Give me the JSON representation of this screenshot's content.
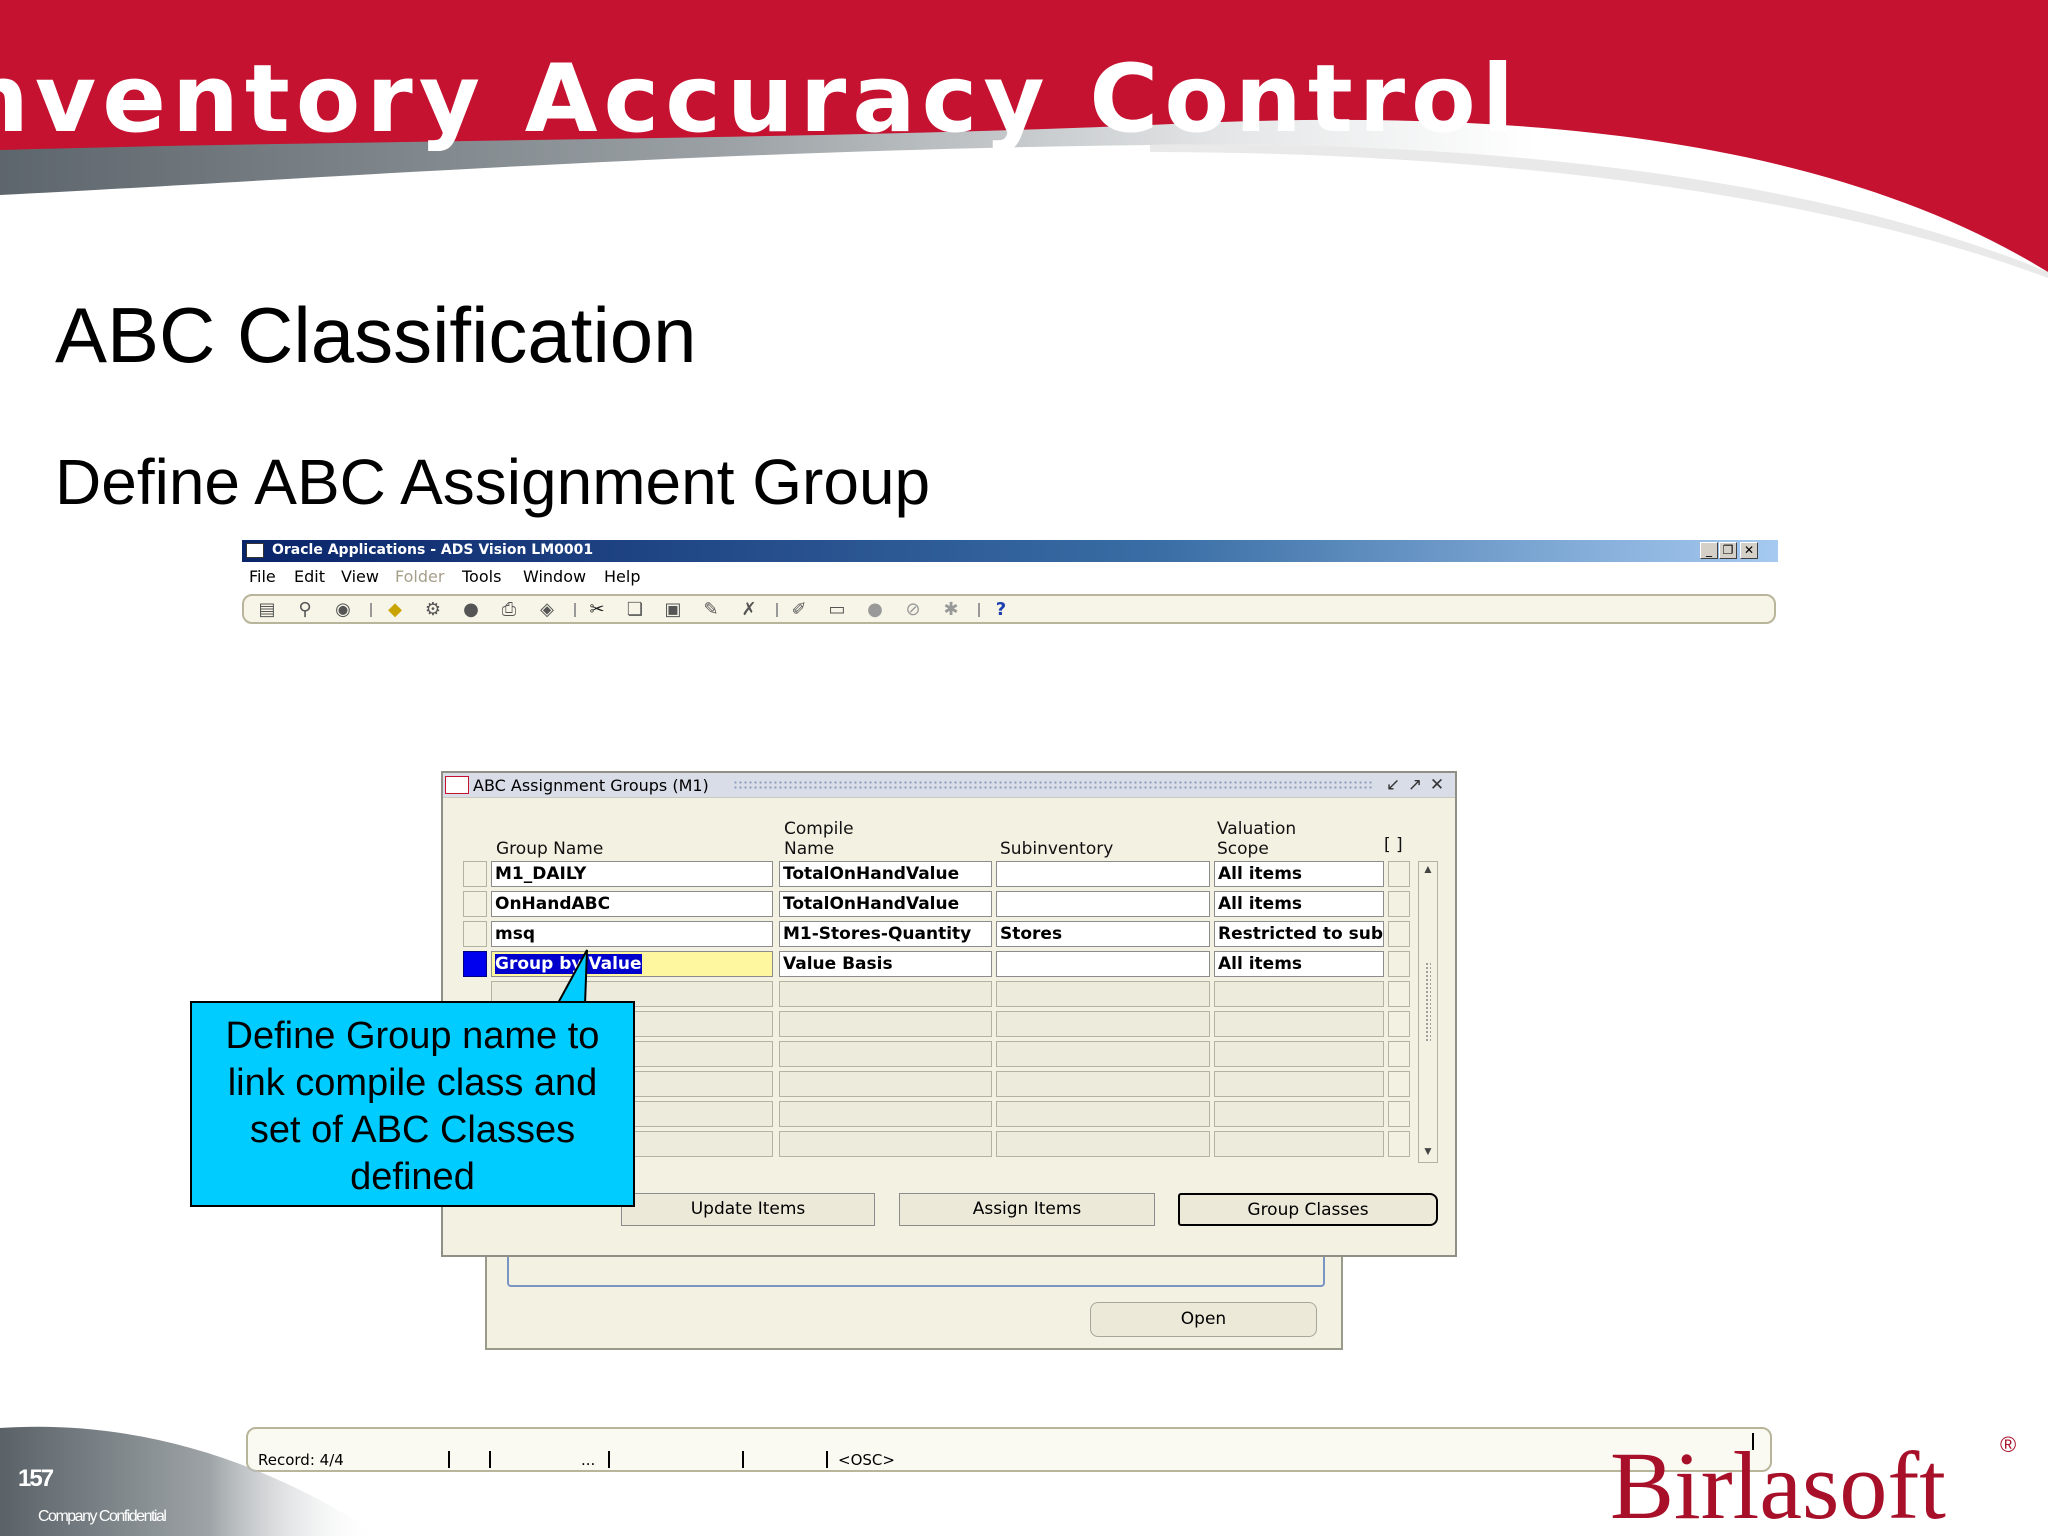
{
  "slide": {
    "title": "nventory Accuracy Control",
    "heading": "ABC Classification",
    "subheading": "Define ABC Assignment Group",
    "page_number": "157",
    "confidential": "Company Confidential",
    "brand": "Birlasoft",
    "brand_visible": "Birlasoft",
    "brand_mark": "®"
  },
  "colors": {
    "banner_red": "#c41230",
    "callout_blue": "#00ccff",
    "selection_blue": "#0000cc",
    "form_bg": "#f2f1e2"
  },
  "oracle_window": {
    "title": "Oracle Applications - ADS Vision LM0001",
    "menu": [
      "File",
      "Edit",
      "View",
      "Folder",
      "Tools",
      "Window",
      "Help"
    ],
    "toolbar_icons": [
      "new-icon",
      "find-icon",
      "navigator-icon",
      "save-icon",
      "next-step-icon",
      "switch-responsibility-icon",
      "print-icon",
      "close-form-icon",
      "cut-icon",
      "copy-icon",
      "paste-icon",
      "clear-record-icon",
      "delete-record-icon",
      "edit-field-icon",
      "zoom-icon",
      "translations-icon",
      "attachments-icon",
      "folder-tools-icon",
      "help-icon"
    ]
  },
  "abc_window": {
    "title": "ABC Assignment Groups (M1)",
    "headers": {
      "group_name": "Group Name",
      "compile_name_1": "Compile",
      "compile_name_2": "Name",
      "subinventory": "Subinventory",
      "valuation_1": "Valuation",
      "valuation_2": "Scope",
      "extra": "[ ]"
    },
    "rows": [
      {
        "group": "M1_DAILY",
        "compile": "TotalOnHandValue",
        "subinv": "",
        "scope": "All items"
      },
      {
        "group": "OnHandABC",
        "compile": "TotalOnHandValue",
        "subinv": "",
        "scope": "All items"
      },
      {
        "group": "msq",
        "compile": "M1-Stores-Quantity",
        "subinv": "Stores",
        "scope": "Restricted to subi"
      },
      {
        "group": "Group by Value",
        "compile": "Value Basis",
        "subinv": "",
        "scope": "All items"
      }
    ],
    "buttons": {
      "update": "Update Items",
      "assign": "Assign Items",
      "group_classes": "Group Classes"
    }
  },
  "background_form": {
    "open_button": "Open"
  },
  "callout": {
    "line1": "Define Group name to",
    "line2": "link compile class and",
    "line3": "set of ABC Classes",
    "line4": "defined"
  },
  "status_bar": {
    "record": "Record: 4/4",
    "ellipsis": "...",
    "mode": "<OSC>"
  }
}
